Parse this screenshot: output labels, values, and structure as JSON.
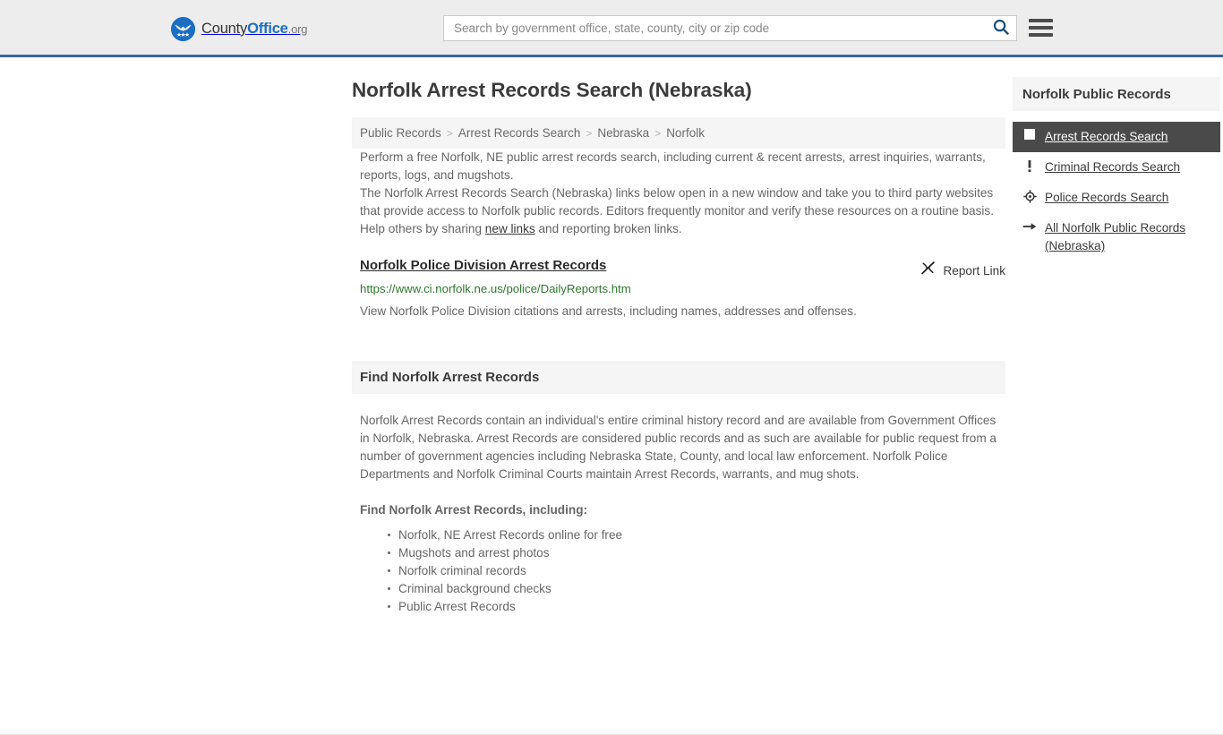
{
  "header": {
    "brand": {
      "prefix": "County",
      "bold": "Office",
      "tld": ".org",
      "logo_icon": "eagle-stars-icon"
    },
    "search": {
      "placeholder": "Search by government office, state, county, city or zip code",
      "value": "",
      "icon": "search-icon"
    },
    "menu_icon": "hamburger-menu-icon",
    "accent_color": "#35699c"
  },
  "page": {
    "title": "Norfolk Arrest Records Search (Nebraska)"
  },
  "breadcrumb": {
    "separator": ">",
    "items": [
      {
        "label": "Public Records",
        "current": false
      },
      {
        "label": "Arrest Records Search",
        "current": false
      },
      {
        "label": "Nebraska",
        "current": false
      },
      {
        "label": "Norfolk",
        "current": true
      }
    ]
  },
  "intro": {
    "p1": "Perform a free Norfolk, NE public arrest records search, including current & recent arrests, arrest inquiries, warrants, reports, logs, and mugshots.",
    "p2": "The Norfolk Arrest Records Search (Nebraska) links below open in a new window and take you to third party websites that provide access to Norfolk public records. Editors frequently monitor and verify these resources on a routine basis.",
    "p3_before": "Help others by sharing ",
    "p3_link": "new links",
    "p3_after": " and reporting broken links."
  },
  "result": {
    "title": "Norfolk Police Division Arrest Records",
    "url": "https://www.ci.norfolk.ne.us/police/DailyReports.htm",
    "description": "View Norfolk Police Division citations and arrests, including names, addresses and offenses.",
    "report_label": "Report Link",
    "report_icon": "broken-link-icon",
    "url_color": "#2d7a2d"
  },
  "section": {
    "heading": "Find Norfolk Arrest Records",
    "paragraph": "Norfolk Arrest Records contain an individual's entire criminal history record and are available from Government Offices in Norfolk, Nebraska. Arrest Records are considered public records and as such are available for public request from a number of government agencies including Nebraska State, County, and local law enforcement. Norfolk Police Departments and Norfolk Criminal Courts maintain Arrest Records, warrants, and mug shots.",
    "list_heading": "Find Norfolk Arrest Records, including:",
    "list": [
      "Norfolk, NE Arrest Records online for free",
      "Mugshots and arrest photos",
      "Norfolk criminal records",
      "Criminal background checks",
      "Public Arrest Records"
    ]
  },
  "sidebar": {
    "heading": "Norfolk Public Records",
    "active_bg": "#4a4a4a",
    "items": [
      {
        "label": "Arrest Records Search",
        "icon": "filled-square-icon",
        "active": true
      },
      {
        "label": "Criminal Records Search",
        "icon": "exclamation-icon",
        "active": false
      },
      {
        "label": "Police Records Search",
        "icon": "crosshair-icon",
        "active": false
      },
      {
        "label": "All Norfolk Public Records (Nebraska)",
        "icon": "arrow-right-icon",
        "active": false
      }
    ]
  }
}
